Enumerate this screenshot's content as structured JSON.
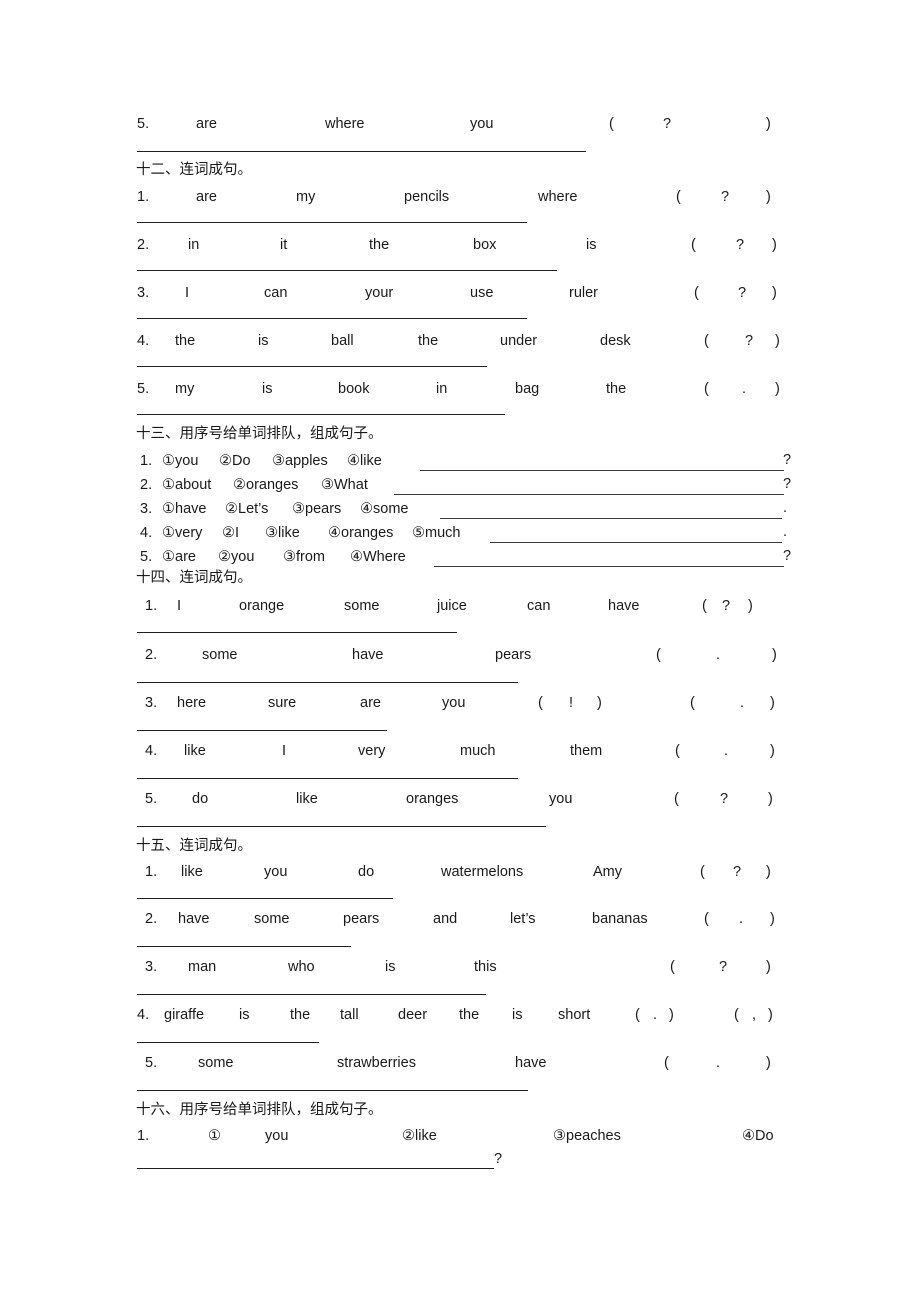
{
  "document": {
    "type": "chinese-english-worksheet",
    "page_background": "#ffffff",
    "text_color": "#1a1a1a"
  },
  "sections": [
    {
      "id": "sec-11-tail",
      "heading": "",
      "rows": [
        {
          "number": "5.",
          "words": [
            "are",
            "where",
            "you"
          ],
          "paren_open": "(",
          "paren_punct": "?",
          "paren_close": ")"
        }
      ]
    },
    {
      "id": "sec-12",
      "heading": "十二、连词成句。",
      "rows": [
        {
          "number": "1.",
          "words": [
            "are",
            "my",
            "pencils",
            "where"
          ],
          "paren_open": "(",
          "paren_punct": "?",
          "paren_close": ")"
        },
        {
          "number": "2.",
          "words": [
            "in",
            "it",
            "the",
            "box",
            "is"
          ],
          "paren_open": "(",
          "paren_punct": "?",
          "paren_close": ")"
        },
        {
          "number": "3.",
          "words": [
            "I",
            "can",
            "your",
            "use",
            "ruler"
          ],
          "paren_open": "(",
          "paren_punct": "?",
          "paren_close": ")"
        },
        {
          "number": "4.",
          "words": [
            "the",
            "is",
            "ball",
            "the",
            "under",
            "desk"
          ],
          "paren_open": "(",
          "paren_punct": "?",
          "paren_close": ")"
        },
        {
          "number": "5.",
          "words": [
            "my",
            "is",
            "book",
            "in",
            "bag",
            "the"
          ],
          "paren_open": "(",
          "paren_punct": ".",
          "paren_close": ")"
        }
      ]
    },
    {
      "id": "sec-13",
      "heading": "十三、用序号给单词排队，组成句子。",
      "rows": [
        {
          "number": "1.",
          "items": [
            "①you",
            "②Do",
            "③apples",
            "④like"
          ],
          "end_punct": "?"
        },
        {
          "number": "2.",
          "items": [
            "①about",
            "②oranges",
            "③What"
          ],
          "end_punct": "?"
        },
        {
          "number": "3.",
          "items": [
            "①have",
            "②Let’s",
            "③pears",
            "④some"
          ],
          "end_punct": "."
        },
        {
          "number": "4.",
          "items": [
            "①very",
            "②I",
            "③like",
            "④oranges",
            "⑤much"
          ],
          "end_punct": "."
        },
        {
          "number": "5.",
          "items": [
            "①are",
            "②you",
            "③from",
            "④Where"
          ],
          "end_punct": "?"
        }
      ]
    },
    {
      "id": "sec-14",
      "heading": "十四、连词成句。",
      "rows": [
        {
          "number": "1.",
          "words": [
            "I",
            "orange",
            "some",
            "juice",
            "can",
            "have"
          ],
          "paren_open": "(",
          "paren_punct": "?",
          "paren_close": ")"
        },
        {
          "number": "2.",
          "words": [
            "some",
            "have",
            "pears"
          ],
          "paren_open": "(",
          "paren_punct": ".",
          "paren_close": ")"
        },
        {
          "number": "3.",
          "words": [
            "here",
            "sure",
            "are",
            "you"
          ],
          "paren_open": "(",
          "paren_punct": "!",
          "paren_close": ")",
          "paren2_open": "(",
          "paren2_punct": ".",
          "paren2_close": ")"
        },
        {
          "number": "4.",
          "words": [
            "like",
            "I",
            "very",
            "much",
            "them"
          ],
          "paren_open": "(",
          "paren_punct": ".",
          "paren_close": ")"
        },
        {
          "number": "5.",
          "words": [
            "do",
            "like",
            "oranges",
            "you"
          ],
          "paren_open": "(",
          "paren_punct": "?",
          "paren_close": ")"
        }
      ]
    },
    {
      "id": "sec-15",
      "heading": "十五、连词成句。",
      "rows": [
        {
          "number": "1.",
          "words": [
            "like",
            "you",
            "do",
            "watermelons",
            "Amy"
          ],
          "paren_open": "(",
          "paren_punct": "?",
          "paren_close": ")"
        },
        {
          "number": "2.",
          "words": [
            "have",
            "some",
            "pears",
            "and",
            "let’s",
            "bananas"
          ],
          "paren_open": "(",
          "paren_punct": ".",
          "paren_close": ")"
        },
        {
          "number": "3.",
          "words": [
            "man",
            "who",
            "is",
            "this"
          ],
          "paren_open": "(",
          "paren_punct": "?",
          "paren_close": ")"
        },
        {
          "number": "4.",
          "words": [
            "giraffe",
            "is",
            "the",
            "tall",
            "deer",
            "the",
            "is",
            "short"
          ],
          "paren_open": "(",
          "paren_punct": ".",
          "paren_close": ")",
          "paren2_open": "(",
          "paren2_punct": ",",
          "paren2_close": ")"
        },
        {
          "number": "5.",
          "words": [
            "some",
            "strawberries",
            "have"
          ],
          "paren_open": "(",
          "paren_punct": ".",
          "paren_close": ")"
        }
      ]
    },
    {
      "id": "sec-16",
      "heading": "十六、用序号给单词排队，组成句子。",
      "rows": [
        {
          "number": "1.",
          "items": [
            "①",
            "you",
            "②like",
            "③peaches",
            "④Do"
          ],
          "end_punct": "?"
        }
      ]
    }
  ]
}
